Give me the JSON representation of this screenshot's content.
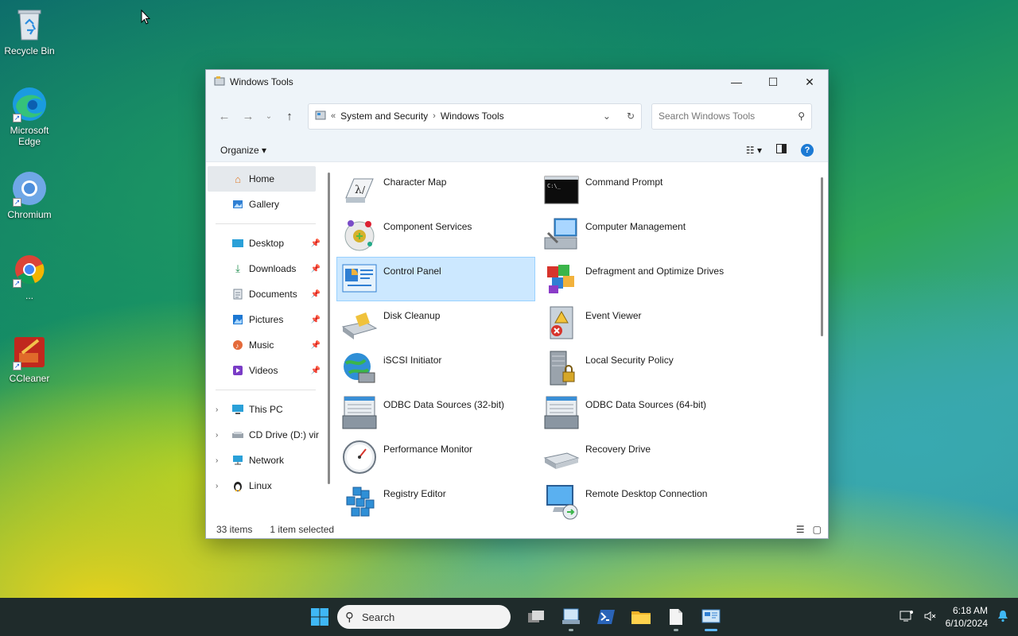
{
  "desktop": {
    "icons": [
      {
        "label": "Recycle Bin",
        "icon": "recycle-bin-icon"
      },
      {
        "label": "Microsoft Edge",
        "icon": "edge-icon"
      },
      {
        "label": "Chromium",
        "icon": "chromium-icon"
      },
      {
        "label": "...",
        "icon": "chrome-icon"
      },
      {
        "label": "CCleaner",
        "icon": "ccleaner-icon"
      }
    ]
  },
  "window": {
    "title": "Windows Tools",
    "controls": {
      "minimize": "—",
      "maximize": "☐",
      "close": "✕"
    },
    "address": {
      "overflow": "«",
      "crumbs": [
        "System and Security",
        "Windows Tools"
      ]
    },
    "search": {
      "placeholder": "Search Windows Tools"
    },
    "toolbar": {
      "organize": "Organize"
    },
    "nav": {
      "home": "Home",
      "gallery": "Gallery",
      "quick": [
        "Desktop",
        "Downloads",
        "Documents",
        "Pictures",
        "Music",
        "Videos"
      ],
      "drives": [
        "This PC",
        "CD Drive (D:) vir",
        "Network",
        "Linux"
      ]
    },
    "items": [
      {
        "label": "Character Map",
        "icon": "character-map-icon"
      },
      {
        "label": "Command Prompt",
        "icon": "command-prompt-icon"
      },
      {
        "label": "Component Services",
        "icon": "component-services-icon"
      },
      {
        "label": "Computer Management",
        "icon": "computer-management-icon"
      },
      {
        "label": "Control Panel",
        "icon": "control-panel-icon",
        "selected": true
      },
      {
        "label": "Defragment and Optimize Drives",
        "icon": "defragment-icon"
      },
      {
        "label": "Disk Cleanup",
        "icon": "disk-cleanup-icon"
      },
      {
        "label": "Event Viewer",
        "icon": "event-viewer-icon"
      },
      {
        "label": "iSCSI Initiator",
        "icon": "iscsi-icon"
      },
      {
        "label": "Local Security Policy",
        "icon": "security-policy-icon"
      },
      {
        "label": "ODBC Data Sources (32-bit)",
        "icon": "odbc-icon"
      },
      {
        "label": "ODBC Data Sources (64-bit)",
        "icon": "odbc-icon"
      },
      {
        "label": "Performance Monitor",
        "icon": "performance-monitor-icon"
      },
      {
        "label": "Recovery Drive",
        "icon": "recovery-drive-icon"
      },
      {
        "label": "Registry Editor",
        "icon": "registry-editor-icon"
      },
      {
        "label": "Remote Desktop Connection",
        "icon": "remote-desktop-icon"
      }
    ],
    "status": {
      "count": "33 items",
      "selected": "1 item selected"
    }
  },
  "taskbar": {
    "search": "Search",
    "time": "6:18 AM",
    "date": "6/10/2024"
  }
}
